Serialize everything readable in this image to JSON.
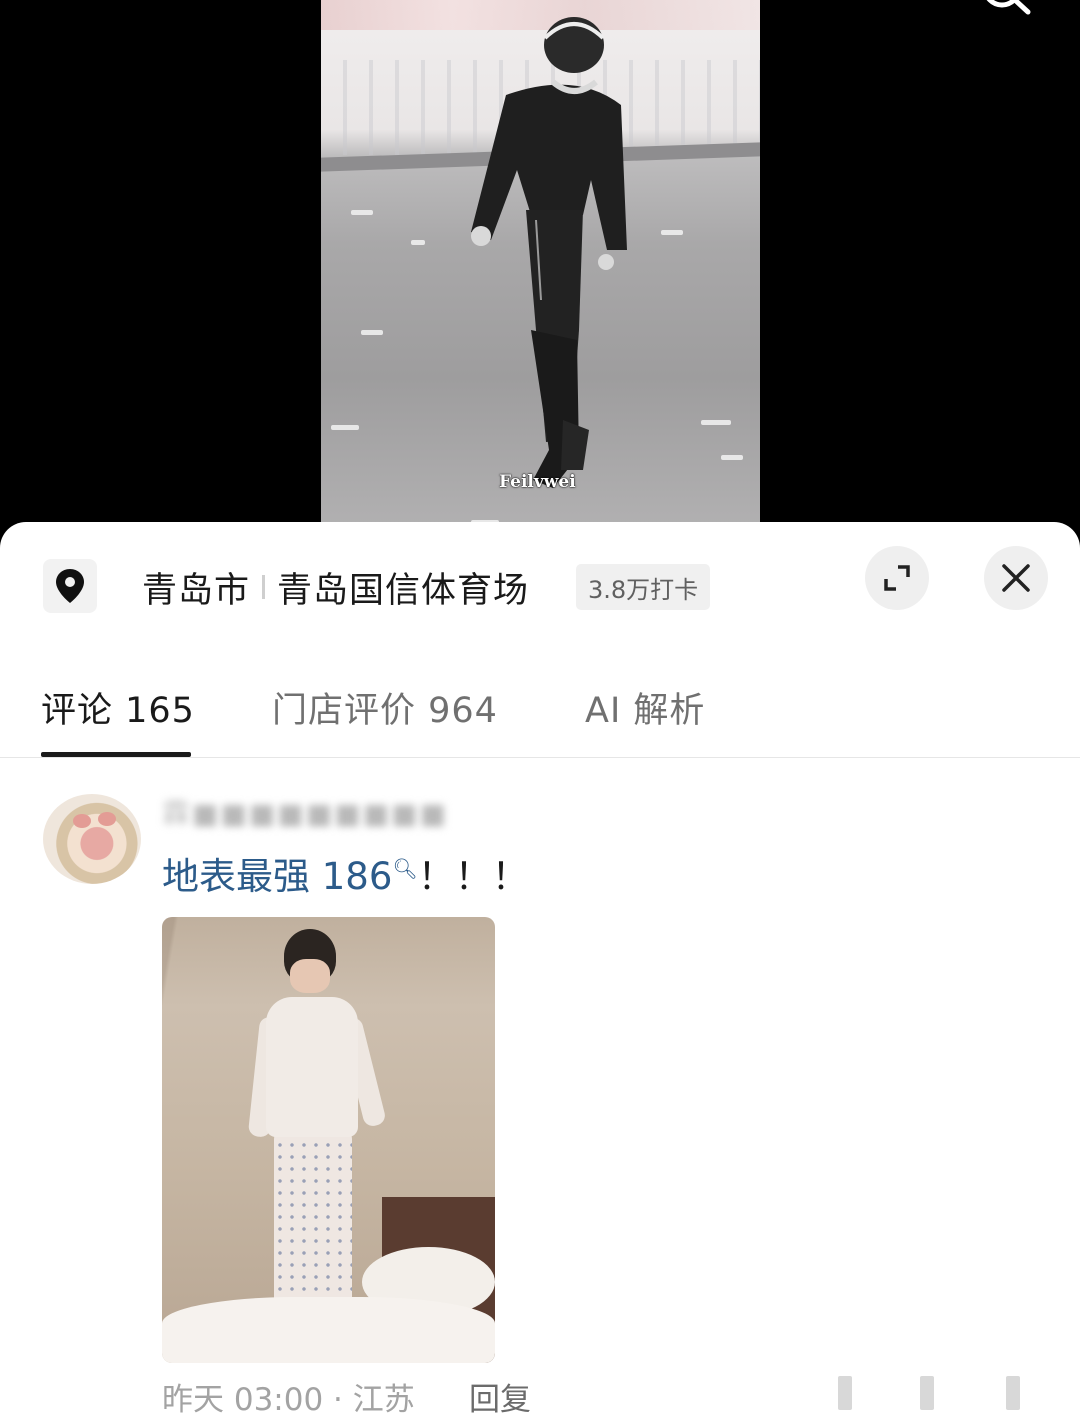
{
  "video": {
    "watermark": "Feilvwei"
  },
  "location": {
    "city": "青岛市",
    "venue": "青岛国信体育场",
    "checkins": "3.8万打卡"
  },
  "tabs": [
    {
      "label": "评论 165",
      "active": true
    },
    {
      "label": "门店评价 964",
      "active": false
    },
    {
      "label": "AI 解析",
      "active": false
    }
  ],
  "comment": {
    "username": "霖■■■■■■■■■",
    "hashtag": "地表最强 186",
    "text_suffix": "！！！",
    "time_location": "昨天 03:00 · 江苏",
    "reply_label": "回复"
  },
  "colors": {
    "link": "#2c5b8a",
    "text": "#1a1a1a",
    "muted": "#a3a3a3"
  },
  "icons": [
    "search-icon",
    "location-pin-icon",
    "expand-icon",
    "close-icon",
    "search-mini-icon"
  ]
}
